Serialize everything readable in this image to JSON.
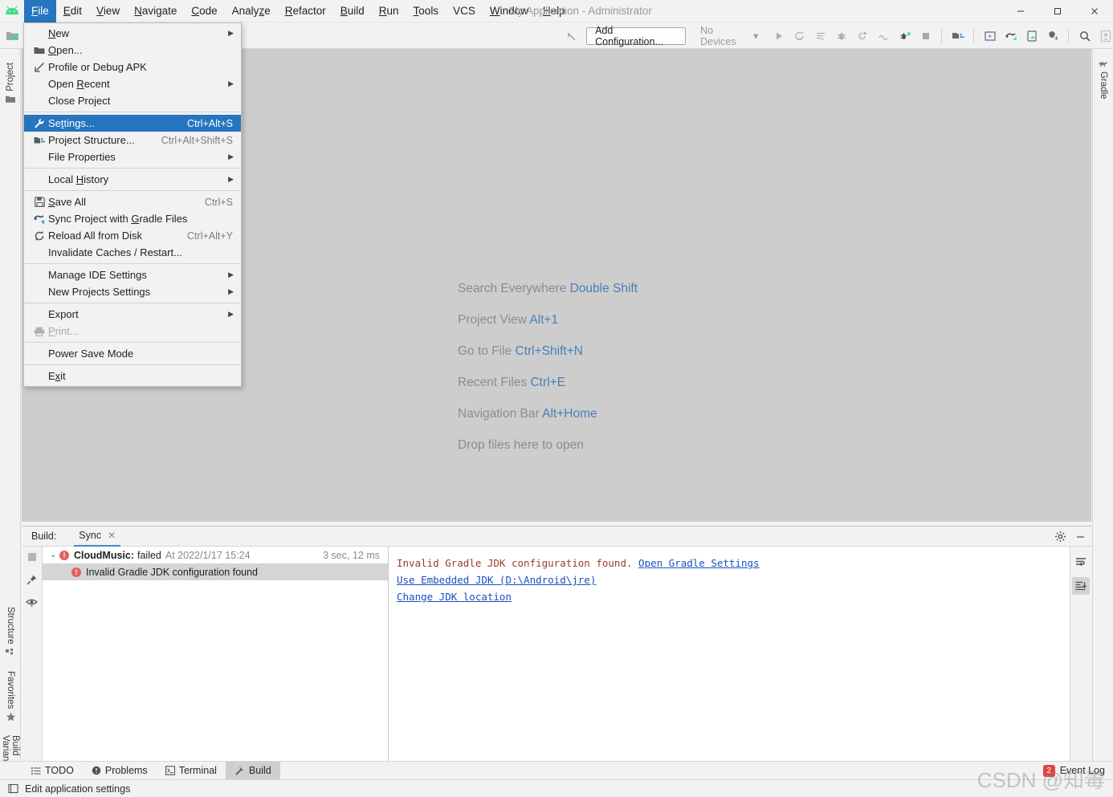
{
  "window": {
    "title": "My Application - Administrator",
    "controls": {
      "minimize": "—",
      "maximize": "▢",
      "close": "✕"
    }
  },
  "menubar": {
    "items": [
      {
        "label": "File",
        "mnemonic": "F",
        "active": true
      },
      {
        "label": "Edit",
        "mnemonic": "E",
        "active": false
      },
      {
        "label": "View",
        "mnemonic": "V",
        "active": false
      },
      {
        "label": "Navigate",
        "mnemonic": "N",
        "active": false
      },
      {
        "label": "Code",
        "mnemonic": "C",
        "active": false
      },
      {
        "label": "Analyze",
        "mnemonic": "z",
        "active": false
      },
      {
        "label": "Refactor",
        "mnemonic": "R",
        "active": false
      },
      {
        "label": "Build",
        "mnemonic": "B",
        "active": false
      },
      {
        "label": "Run",
        "mnemonic": "R",
        "active": false
      },
      {
        "label": "Tools",
        "mnemonic": "T",
        "active": false
      },
      {
        "label": "VCS",
        "mnemonic": "",
        "active": false
      },
      {
        "label": "Window",
        "mnemonic": "W",
        "active": false
      },
      {
        "label": "Help",
        "mnemonic": "H",
        "active": false
      }
    ]
  },
  "file_menu": {
    "items": [
      {
        "label": "New",
        "icon": "",
        "shortcut": "",
        "submenu": true,
        "highlight": false,
        "disabled": false,
        "sep_after": false
      },
      {
        "label": "Open...",
        "icon": "folder-icon",
        "shortcut": "",
        "submenu": false,
        "highlight": false,
        "disabled": false,
        "sep_after": false
      },
      {
        "label": "Profile or Debug APK",
        "icon": "profile-apk-icon",
        "shortcut": "",
        "submenu": false,
        "highlight": false,
        "disabled": false,
        "sep_after": false
      },
      {
        "label": "Open Recent",
        "icon": "",
        "shortcut": "",
        "submenu": true,
        "highlight": false,
        "disabled": false,
        "sep_after": false
      },
      {
        "label": "Close Project",
        "icon": "",
        "shortcut": "",
        "submenu": false,
        "highlight": false,
        "disabled": false,
        "sep_after": true
      },
      {
        "label": "Settings...",
        "icon": "wrench-icon",
        "shortcut": "Ctrl+Alt+S",
        "submenu": false,
        "highlight": true,
        "disabled": false,
        "sep_after": false
      },
      {
        "label": "Project Structure...",
        "icon": "structure-icon",
        "shortcut": "Ctrl+Alt+Shift+S",
        "submenu": false,
        "highlight": false,
        "disabled": false,
        "sep_after": false
      },
      {
        "label": "File Properties",
        "icon": "",
        "shortcut": "",
        "submenu": true,
        "highlight": false,
        "disabled": false,
        "sep_after": true
      },
      {
        "label": "Local History",
        "icon": "",
        "shortcut": "",
        "submenu": true,
        "highlight": false,
        "disabled": false,
        "sep_after": true
      },
      {
        "label": "Save All",
        "icon": "save-icon",
        "shortcut": "Ctrl+S",
        "submenu": false,
        "highlight": false,
        "disabled": false,
        "sep_after": false
      },
      {
        "label": "Sync Project with Gradle Files",
        "icon": "gradle-sync-icon",
        "shortcut": "",
        "submenu": false,
        "highlight": false,
        "disabled": false,
        "sep_after": false
      },
      {
        "label": "Reload All from Disk",
        "icon": "reload-icon",
        "shortcut": "Ctrl+Alt+Y",
        "submenu": false,
        "highlight": false,
        "disabled": false,
        "sep_after": false
      },
      {
        "label": "Invalidate Caches / Restart...",
        "icon": "",
        "shortcut": "",
        "submenu": false,
        "highlight": false,
        "disabled": false,
        "sep_after": true
      },
      {
        "label": "Manage IDE Settings",
        "icon": "",
        "shortcut": "",
        "submenu": true,
        "highlight": false,
        "disabled": false,
        "sep_after": false
      },
      {
        "label": "New Projects Settings",
        "icon": "",
        "shortcut": "",
        "submenu": true,
        "highlight": false,
        "disabled": false,
        "sep_after": true
      },
      {
        "label": "Export",
        "icon": "",
        "shortcut": "",
        "submenu": true,
        "highlight": false,
        "disabled": false,
        "sep_after": false
      },
      {
        "label": "Print...",
        "icon": "printer-icon",
        "shortcut": "",
        "submenu": false,
        "highlight": false,
        "disabled": true,
        "sep_after": true
      },
      {
        "label": "Power Save Mode",
        "icon": "",
        "shortcut": "",
        "submenu": false,
        "highlight": false,
        "disabled": false,
        "sep_after": true
      },
      {
        "label": "Exit",
        "icon": "",
        "shortcut": "",
        "submenu": false,
        "highlight": false,
        "disabled": false,
        "sep_after": false
      }
    ]
  },
  "toolbar": {
    "back_arrow": "back-arrow-icon",
    "add_configuration": "Add Configuration...",
    "device_selector": "No Devices",
    "device_caret": "▾",
    "icons": [
      "run-icon",
      "rerun-icon",
      "apply-changes-icon",
      "debug-icon",
      "attach-debugger-icon",
      "profile-icon",
      "run-coverage-icon",
      "stop-icon"
    ],
    "icons2": [
      "sdk-manager-icon",
      "avd-manager-icon",
      "gradle-sync-icon",
      "layout-inspector-icon",
      "device-file-explorer-icon"
    ],
    "icons3": [
      "search-icon",
      "account-icon"
    ]
  },
  "left_tabs": [
    {
      "label": "Project",
      "icon": "project-folder-icon"
    },
    {
      "label": "Structure",
      "icon": "structure-icon"
    },
    {
      "label": "Favorites",
      "icon": "star-icon"
    },
    {
      "label": "Build Variants",
      "icon": "android-icon"
    }
  ],
  "right_tabs": [
    {
      "label": "Gradle",
      "icon": "gradle-elephant-icon"
    }
  ],
  "editor_hints": [
    {
      "action": "Search Everywhere",
      "key": "Double Shift"
    },
    {
      "action": "Project View",
      "key": "Alt+1"
    },
    {
      "action": "Go to File",
      "key": "Ctrl+Shift+N"
    },
    {
      "action": "Recent Files",
      "key": "Ctrl+E"
    },
    {
      "action": "Navigation Bar",
      "key": "Alt+Home"
    },
    {
      "action": "Drop files here to open",
      "key": ""
    }
  ],
  "build_window": {
    "label": "Build:",
    "tab": {
      "label": "Sync",
      "close": "✕"
    },
    "header_icons": [
      "gear-icon",
      "minimize-icon"
    ],
    "gutter_icons": [
      "stop-icon",
      "pin-icon",
      "eye-icon"
    ],
    "tree": [
      {
        "chevron": "⌄",
        "name": "CloudMusic:",
        "status": "failed",
        "timestamp": "At 2022/1/17 15:24",
        "duration": "3 sec, 12 ms",
        "selected": false,
        "indent": 0,
        "error": true
      },
      {
        "chevron": "",
        "name": "",
        "status": "Invalid Gradle JDK configuration found",
        "timestamp": "",
        "duration": "",
        "selected": true,
        "indent": 1,
        "error": true
      }
    ],
    "console": [
      {
        "text": "Invalid Gradle JDK configuration found. ",
        "link": "Open Gradle Settings"
      },
      {
        "text": "",
        "link": "Use Embedded JDK (D:\\Android\\jre)"
      },
      {
        "text": "",
        "link": "Change JDK location"
      }
    ],
    "side_icons": [
      "soft-wrap-icon",
      "scroll-to-end-icon"
    ]
  },
  "bottom_tabs": [
    {
      "label": "TODO",
      "icon": "todo-icon",
      "active": false
    },
    {
      "label": "Problems",
      "icon": "problems-icon",
      "active": false
    },
    {
      "label": "Terminal",
      "icon": "terminal-icon",
      "active": false
    },
    {
      "label": "Build",
      "icon": "build-hammer-icon",
      "active": true
    }
  ],
  "event_log": {
    "label": "Event Log",
    "count": "2"
  },
  "statusbar": {
    "icon": "memory-icon",
    "text": "Edit application settings"
  },
  "watermark": "CSDN @知毒",
  "colors": {
    "accent": "#2675bf",
    "link": "#1a4fbf",
    "hint_key": "#4a7fb5",
    "error": "#e26060",
    "editor_bg": "#cdcdcd",
    "chrome_bg": "#f2f2f2"
  }
}
